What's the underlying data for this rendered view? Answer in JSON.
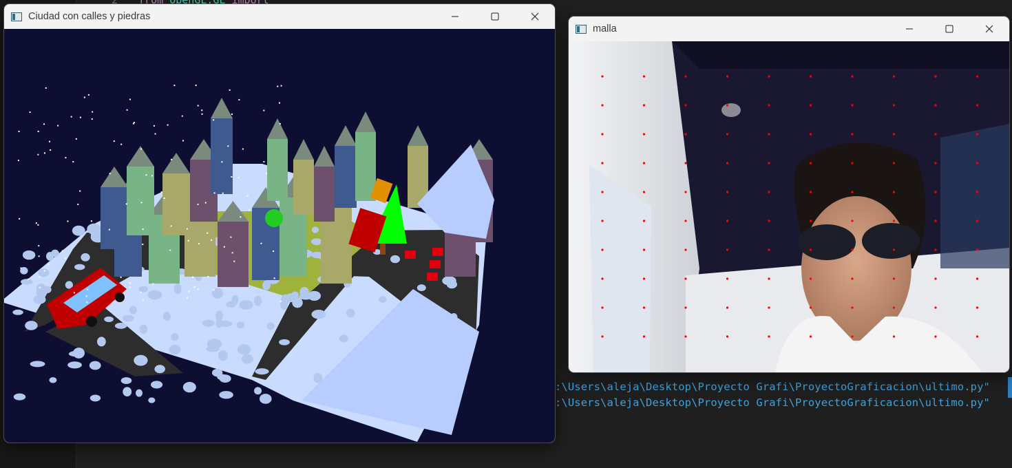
{
  "editor": {
    "line_number": "2",
    "code_from": "from ",
    "code_module": "OpenGL.GL ",
    "code_import": "import",
    "terminal_lines": [
      ":\\Users\\aleja\\Desktop\\Proyecto Grafi\\ProyectoGraficacion\\ultimo.py\"",
      ":\\Users\\aleja\\Desktop\\Proyecto Grafi\\ProyectoGraficacion\\ultimo.py\""
    ]
  },
  "windows": {
    "city": {
      "title": "Ciudad con calles y piedras"
    },
    "mesh": {
      "title": "malla"
    }
  },
  "colors": {
    "city_background": "#0e0e33",
    "snow": "#c7dbff",
    "building_palette": [
      "#3f5a8e",
      "#79b487",
      "#a8a86a",
      "#6c506c"
    ],
    "tree": "#00ff00",
    "bus": "#c40000",
    "mesh_point": "#ff0000"
  },
  "icons": {
    "app": "app-window-icon",
    "minimize": "minimize-icon",
    "maximize": "maximize-icon",
    "close": "close-icon"
  }
}
